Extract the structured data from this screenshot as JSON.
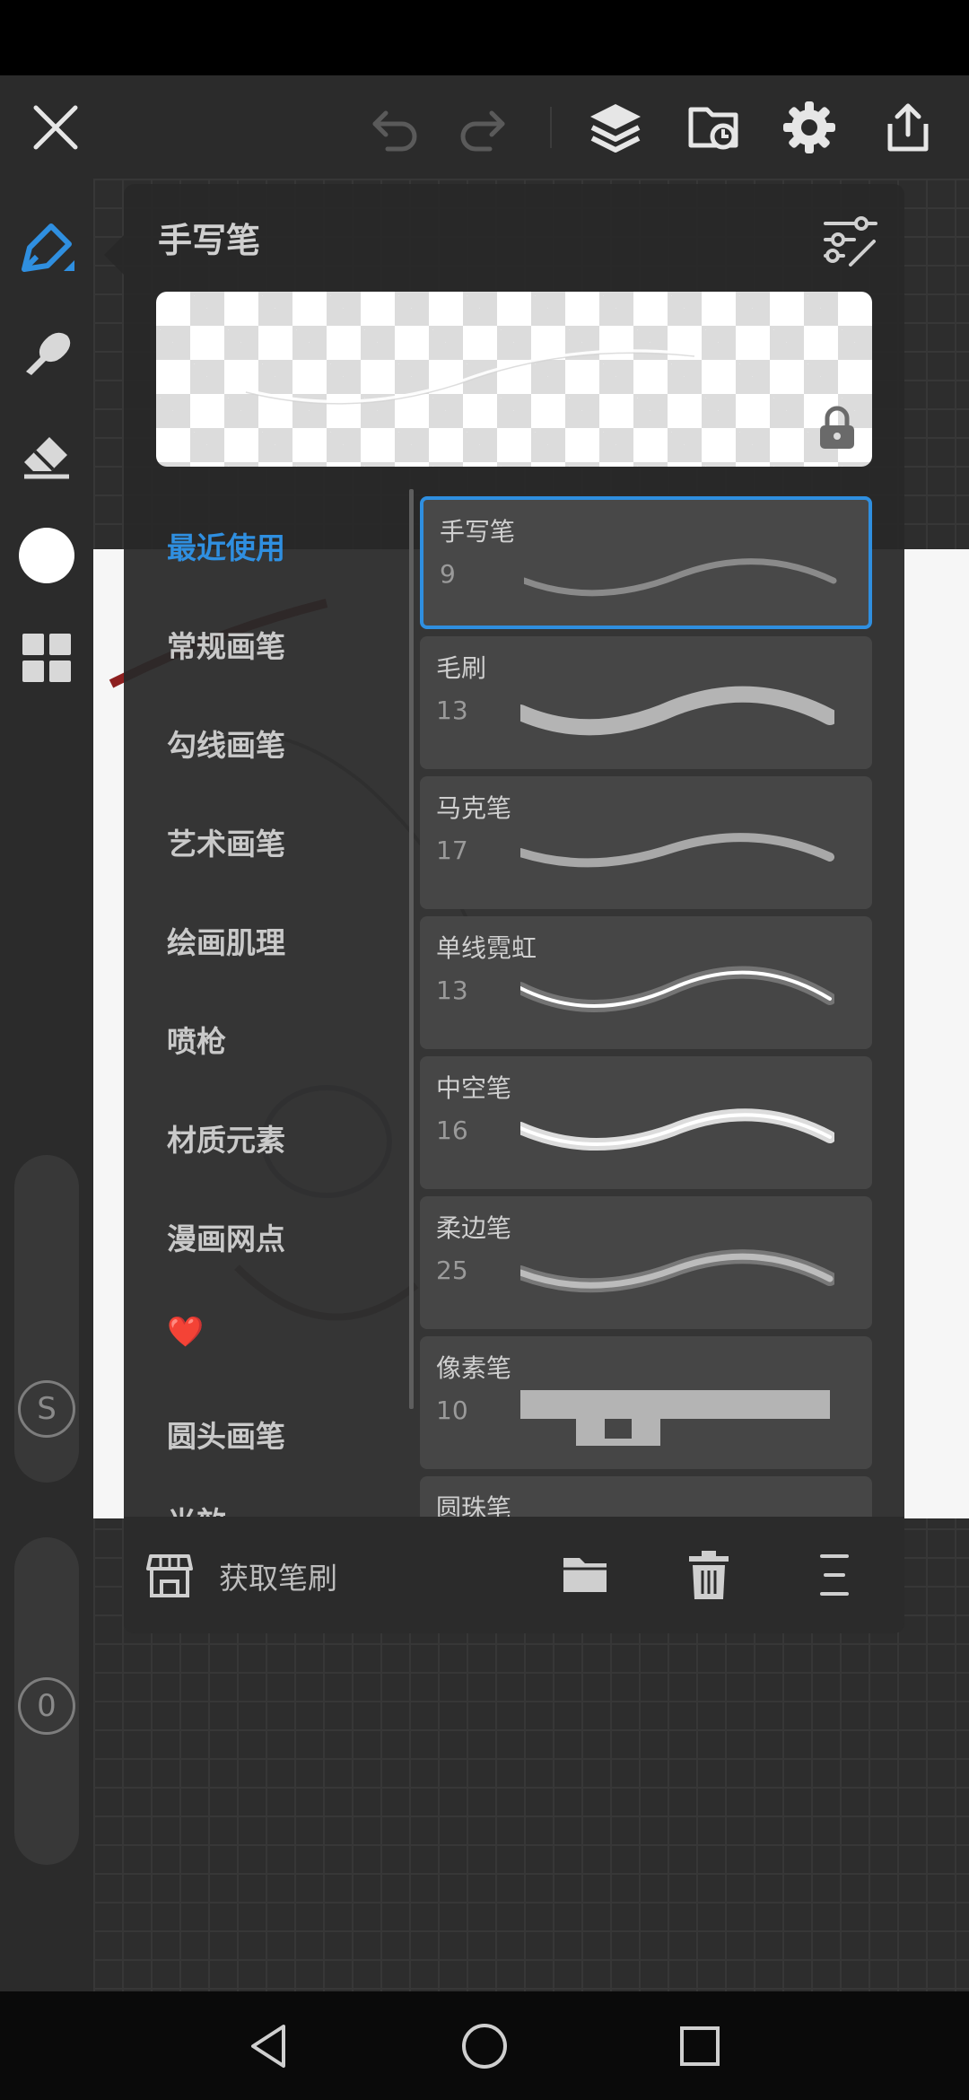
{
  "panel": {
    "title": "手写笔",
    "categories": [
      {
        "label": "最近使用",
        "active": true
      },
      {
        "label": "常规画笔",
        "active": false
      },
      {
        "label": "勾线画笔",
        "active": false
      },
      {
        "label": "艺术画笔",
        "active": false
      },
      {
        "label": "绘画肌理",
        "active": false
      },
      {
        "label": "喷枪",
        "active": false
      },
      {
        "label": "材质元素",
        "active": false
      },
      {
        "label": "漫画网点",
        "active": false
      },
      {
        "label": "❤️",
        "active": false
      },
      {
        "label": "圆头画笔",
        "active": false
      },
      {
        "label": "光效",
        "active": false
      }
    ],
    "brushes": [
      {
        "name": "手写笔",
        "size": "9",
        "selected": true
      },
      {
        "name": "毛刷",
        "size": "13",
        "selected": false
      },
      {
        "name": "马克笔",
        "size": "17",
        "selected": false
      },
      {
        "name": "单线霓虹",
        "size": "13",
        "selected": false
      },
      {
        "name": "中空笔",
        "size": "16",
        "selected": false
      },
      {
        "name": "柔边笔",
        "size": "25",
        "selected": false
      },
      {
        "name": "像素笔",
        "size": "10",
        "selected": false
      },
      {
        "name": "圆珠笔",
        "size": "",
        "selected": false
      }
    ],
    "footer": {
      "get_brushes_label": "获取笔刷"
    }
  },
  "left_toolbar": {
    "size_slider_label": "S",
    "opacity_slider_label": "0",
    "current_color": "#ffffff",
    "accent_color": "#2f8fe0"
  },
  "icons": {
    "top": [
      "close-icon",
      "undo-icon",
      "redo-icon",
      "layers-icon",
      "import-icon",
      "gear-icon",
      "share-icon"
    ],
    "left": [
      "brush-icon",
      "smudge-icon",
      "eraser-icon",
      "color-swatch",
      "gallery-icon"
    ],
    "footer": [
      "store-icon",
      "folder-icon",
      "trash-icon",
      "menu-icon"
    ],
    "nav": [
      "back-icon",
      "home-icon",
      "recents-icon"
    ]
  }
}
